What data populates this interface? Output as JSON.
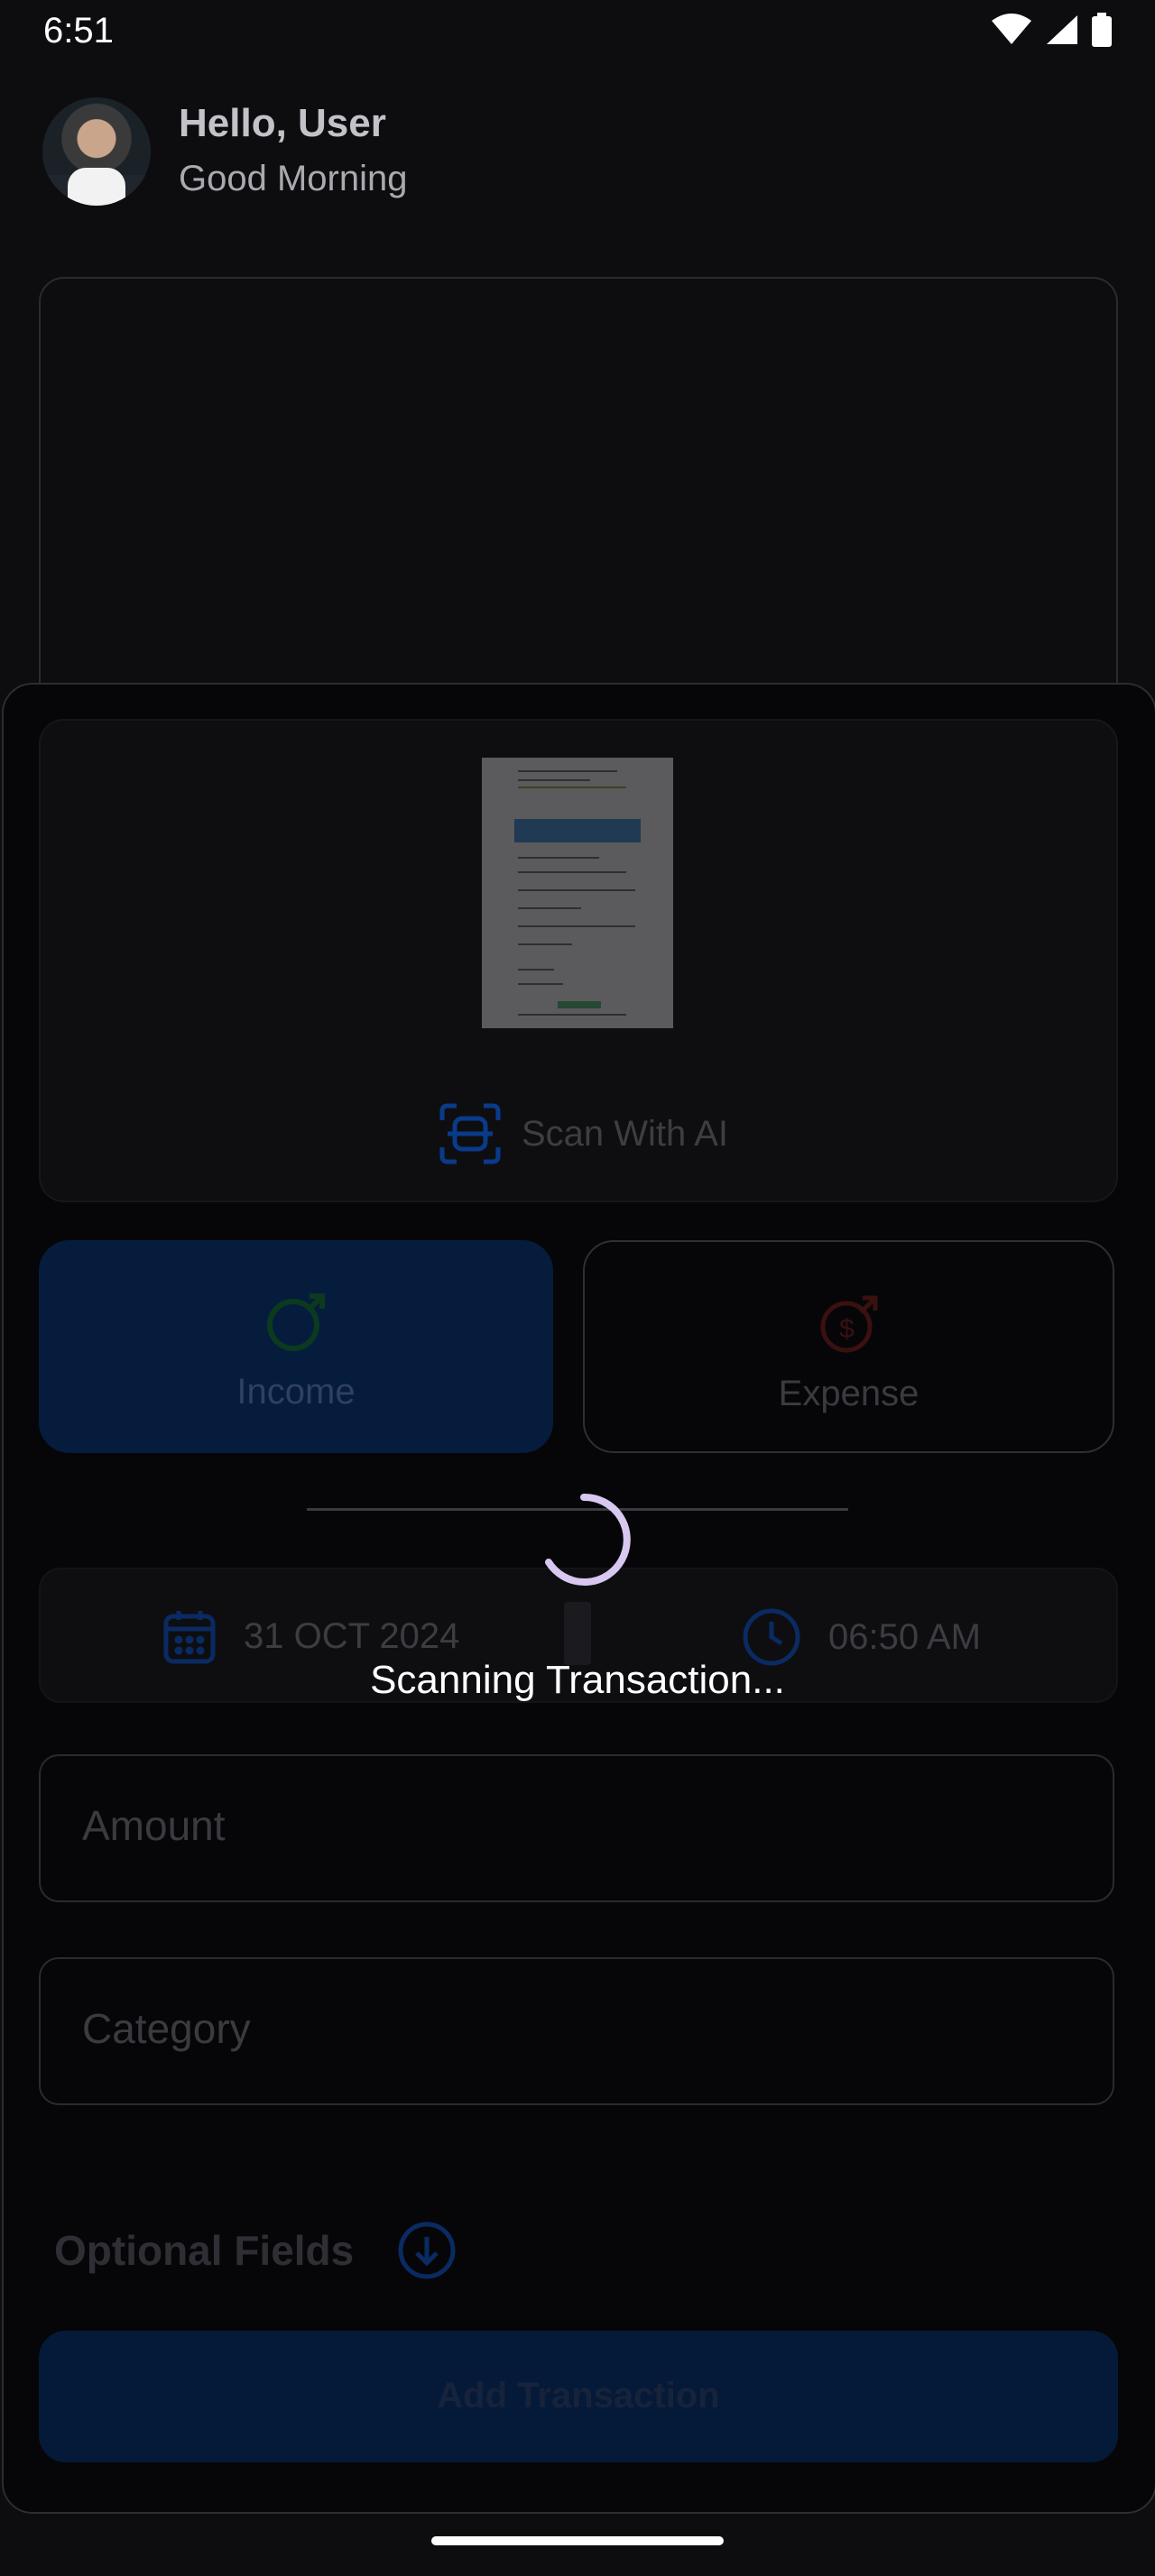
{
  "status_bar": {
    "time": "6:51",
    "icons": [
      "wifi-icon",
      "signal-icon",
      "battery-icon"
    ]
  },
  "header": {
    "greeting": "Hello, User",
    "subtitle": "Good Morning"
  },
  "scan": {
    "label": "Scan With AI"
  },
  "type_toggle": {
    "income_label": "Income",
    "expense_label": "Expense",
    "selected": "Income"
  },
  "datetime": {
    "date": "31 OCT 2024",
    "time": "06:50 AM"
  },
  "fields": {
    "amount_placeholder": "Amount",
    "category_placeholder": "Category"
  },
  "optional": {
    "label": "Optional Fields"
  },
  "actions": {
    "add_label": "Add Transaction"
  },
  "loading": {
    "text": "Scanning Transaction..."
  },
  "colors": {
    "accent": "#0a5cff",
    "expense": "#e53935",
    "spinner": "#d8c8f0"
  }
}
